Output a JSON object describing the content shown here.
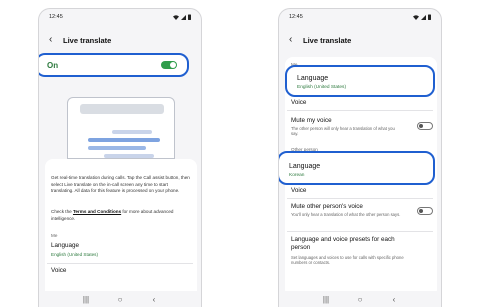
{
  "left_screen": {
    "status": {
      "time": "12:45"
    },
    "header": {
      "title": "Live translate"
    },
    "on_row": {
      "label": "On"
    },
    "description": "Get real-time translation during calls. Tap the Call assist button, then select Live translate on the in-call screen any time to start translating. All data for this feature is processed on your phone.",
    "terms_prefix": "Check the ",
    "terms_link": "Terms and Conditions",
    "terms_suffix": " for more about advanced intelligence.",
    "section_me": "Me",
    "language": {
      "title": "Language",
      "value": "English (United States)"
    },
    "voice": {
      "title": "Voice"
    }
  },
  "right_screen": {
    "status": {
      "time": "12:45"
    },
    "header": {
      "title": "Live translate"
    },
    "section_me": "Me",
    "my_language": {
      "title": "Language",
      "value": "English (United States)"
    },
    "voice_me": {
      "title": "Voice"
    },
    "mute_my_voice": {
      "title": "Mute my voice",
      "desc": "The other person will only hear a translation of what you say."
    },
    "section_other": "Other person",
    "other_language": {
      "title": "Language",
      "value": "Korean"
    },
    "voice_other": {
      "title": "Voice"
    },
    "mute_other": {
      "title": "Mute other person's voice",
      "desc": "You'll only hear a translation of what the other person says."
    },
    "presets": {
      "title": "Language and voice presets for each person",
      "desc": "Set languages and voices to use for calls with specific phone numbers or contacts."
    }
  },
  "icons": [
    "back-icon",
    "wifi-icon",
    "signal-icon",
    "battery-icon",
    "recents-icon",
    "home-icon",
    "nav-back-icon"
  ],
  "colors": {
    "highlight": "#1f5fd0",
    "toggle_on": "#2f9d4b",
    "accent_text": "#2d7a3e"
  }
}
